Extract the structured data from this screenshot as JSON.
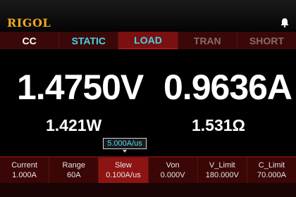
{
  "brand": "RIGOL",
  "tabs": [
    "CC",
    "STATIC",
    "LOAD",
    "TRAN",
    "SHORT"
  ],
  "readings": {
    "voltage": "1.4750V",
    "current": "0.9636A",
    "power": "1.421W",
    "resistance": "1.531Ω"
  },
  "edit_value": "5.000A/us",
  "params": [
    {
      "label": "Current",
      "value": "1.000A"
    },
    {
      "label": "Range",
      "value": "60A"
    },
    {
      "label": "Slew",
      "value": "0.100A/us"
    },
    {
      "label": "Von",
      "value": "0.000V"
    },
    {
      "label": "V_Limit",
      "value": "180.000V"
    },
    {
      "label": "C_Limit",
      "value": "70.000A"
    }
  ],
  "colors": {
    "accent": "#45d6e8",
    "brand": "#f2a91b",
    "selected": "#8e1414"
  }
}
